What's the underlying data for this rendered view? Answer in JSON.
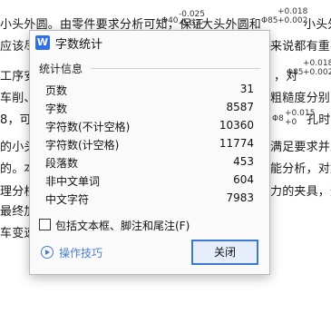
{
  "document": {
    "lines": [
      "小头外圆。由零件要求分析可知，保证",
      "应该尽",
      "工序安",
      "车削、",
      "8，可選",
      "的小头",
      "的。本",
      "理分析",
      "最终加",
      "车变速"
    ],
    "right_fragments": [
      "大头外圆和",
      "小头外",
      "来说都有重要",
      "，对",
      "粗糙度分别为",
      "孔时",
      "满足要求并且",
      "能分析，对加",
      "力的夹具，通"
    ],
    "formula_fragments": [
      "Φ40",
      "-0.025",
      "-0.03",
      "Φ85",
      "+0.018",
      "+0.002",
      "+0.018",
      "+0.002",
      "Φ85",
      "+0.015",
      "+0",
      "Φ8"
    ]
  },
  "dialog": {
    "app_icon_letter": "W",
    "title": "字数统计",
    "group_label": "统计信息",
    "stats": [
      {
        "label": "页数",
        "value": "31"
      },
      {
        "label": "字数",
        "value": "8587"
      },
      {
        "label": "字符数(不计空格)",
        "value": "10360"
      },
      {
        "label": "字符数(计空格)",
        "value": "11774"
      },
      {
        "label": "段落数",
        "value": "453"
      },
      {
        "label": "非中文单词",
        "value": "604"
      },
      {
        "label": "中文字符",
        "value": "7983"
      }
    ],
    "checkbox_label": "包括文本框、脚注和尾注(F)",
    "checkbox_checked": false,
    "tips_label": "操作技巧",
    "close_label": "关闭",
    "accent_color": "#3b78d8",
    "link_color": "#4a7fd4",
    "icon_color": "#2f6fe8"
  }
}
